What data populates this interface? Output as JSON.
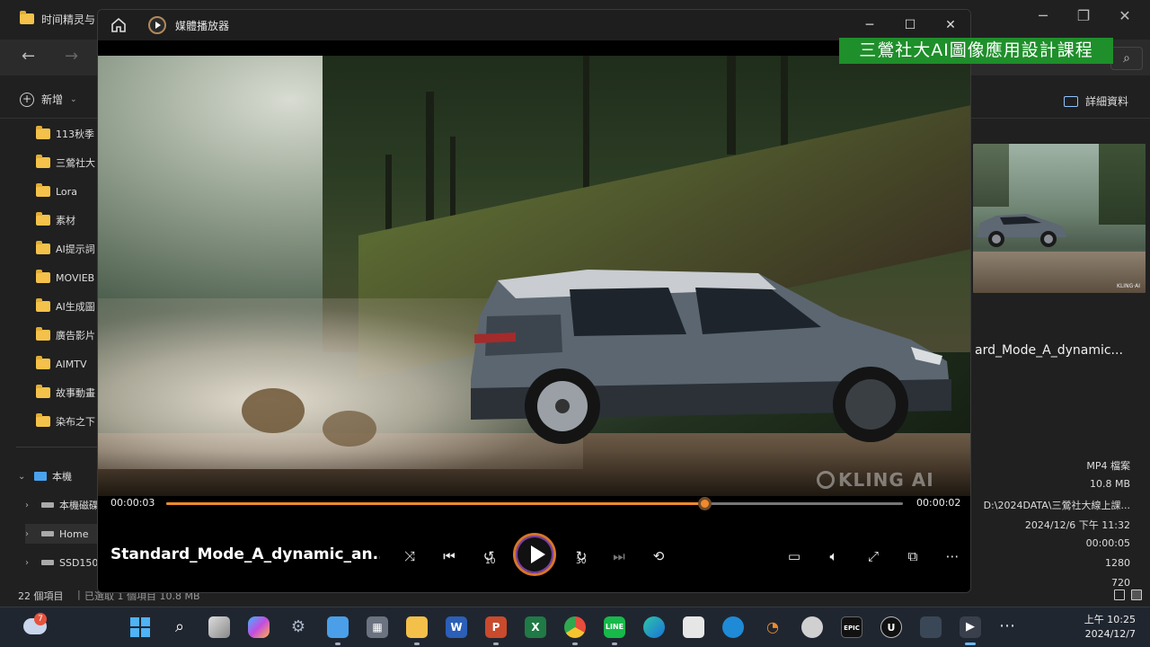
{
  "explorer": {
    "tab_title": "时间精灵与",
    "new_label": "新增",
    "details_label": "詳細資料",
    "sidebar_folders": [
      "113秋季",
      "三鶯社大",
      "Lora",
      "素材",
      "AI提示詞",
      "MOVIEB",
      "AI生成圖",
      "廣告影片",
      "AIMTV",
      "故事動畫",
      "染布之下"
    ],
    "this_pc_label": "本機",
    "drives": [
      "本機磁碟",
      "Home",
      "SSD150"
    ],
    "details": {
      "filename": "ard_Mode_A_dynamic...",
      "thumb_watermark": "KLING·AI",
      "file_type": "MP4 檔案",
      "size": "10.8 MB",
      "path": "D:\\2024DATA\\三鶯社大線上課...",
      "date": "2024/12/6 下午 11:32",
      "duration": "00:00:05",
      "width": "1280",
      "height": "720"
    },
    "status": {
      "item_count": "22 個項目",
      "selected": "已選取 1 個項目  10.8 MB"
    }
  },
  "player": {
    "app_title": "媒體播放器",
    "current_time": "00:00:03",
    "remaining_time": "00:00:02",
    "progress_fraction": 0.73,
    "filename": "Standard_Mode_A_dynamic_an...",
    "watermark": "KLING AI",
    "skip_back_seconds": "10",
    "skip_forward_seconds": "30"
  },
  "banner": {
    "text": "三鶯社大AI圖像應用設計課程",
    "color": "#1e8f2a"
  },
  "taskbar": {
    "weather_badge": "7",
    "clock_time": "上午 10:25",
    "clock_date": "2024/12/7",
    "icons": [
      "start-icon",
      "search-icon",
      "task-view-icon",
      "copilot-icon",
      "settings-icon",
      "notepad-icon",
      "calculator-icon",
      "file-explorer-icon",
      "word-icon",
      "powerpoint-icon",
      "excel-icon",
      "chrome-icon",
      "line-icon",
      "edge-icon",
      "store-icon",
      "vscode-icon",
      "blender-icon",
      "app-icon",
      "epic-games-icon",
      "unreal-icon",
      "davinci-icon",
      "media-player-icon"
    ]
  },
  "colors": {
    "accent_orange": "#f08a2c",
    "windows_blue": "#4aa3ee"
  }
}
